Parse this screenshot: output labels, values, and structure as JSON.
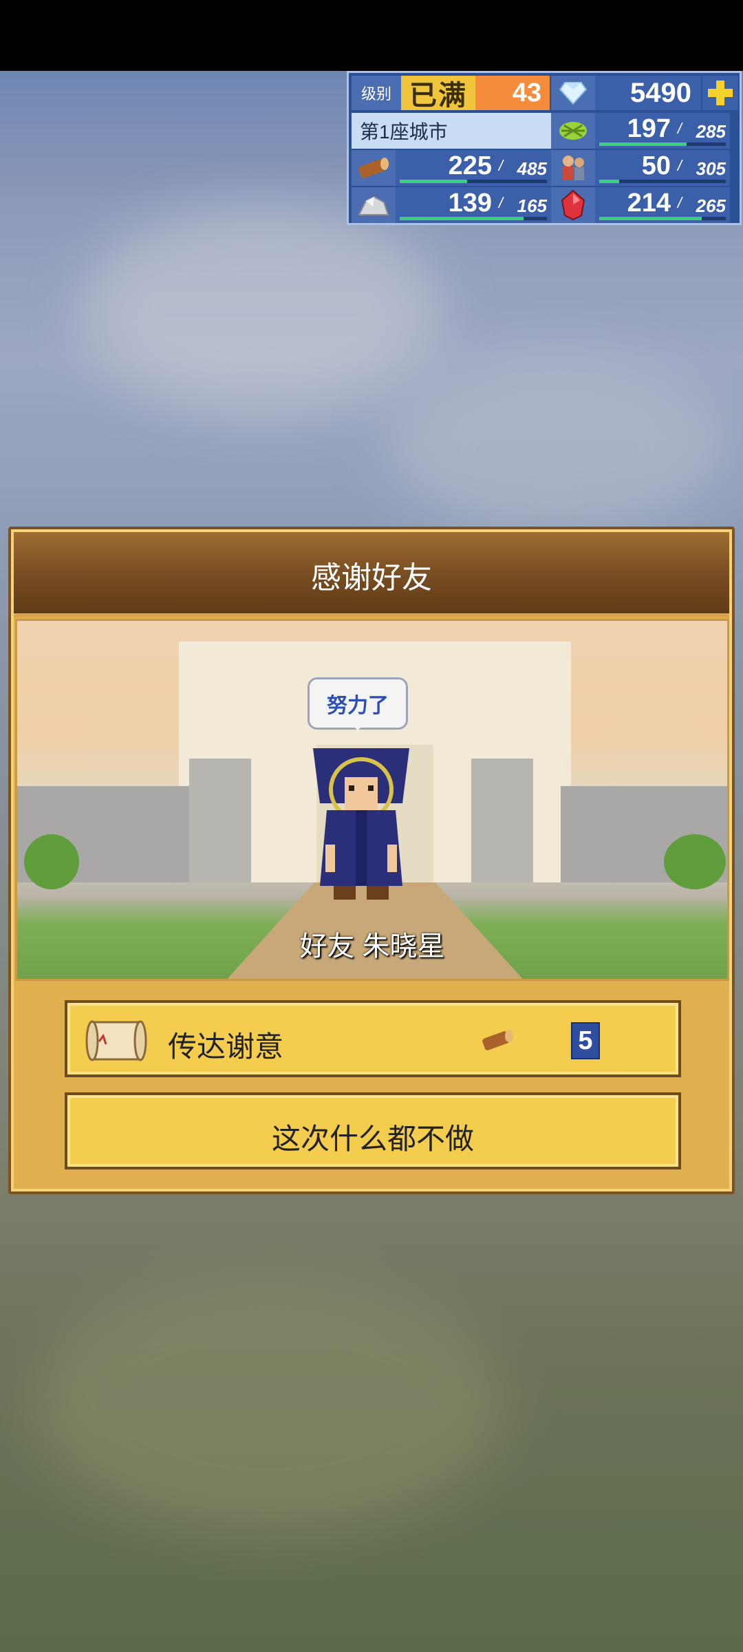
{
  "hud": {
    "level_label": "级别",
    "level_status": "已满",
    "level_value": "43",
    "gems": "5490",
    "city_name": "第1座城市",
    "resources": [
      {
        "icon": "grain-icon",
        "current": "197",
        "max": "285",
        "fill": 0.69
      },
      {
        "icon": "wood-log-icon",
        "current": "225",
        "max": "485",
        "fill": 0.46
      },
      {
        "icon": "workers-icon",
        "current": "50",
        "max": "305",
        "fill": 0.16
      },
      {
        "icon": "ore-icon",
        "current": "139",
        "max": "165",
        "fill": 0.84
      },
      {
        "icon": "red-gem-icon",
        "current": "214",
        "max": "265",
        "fill": 0.81
      }
    ]
  },
  "dialog": {
    "title": "感谢好友",
    "speech": "努力了",
    "friend_name": "好友 朱晓星",
    "thank_label": "传达谢意",
    "thank_cost": "5",
    "skip_label": "这次什么都不做"
  },
  "colors": {
    "hud_bg": "#2d4f94",
    "button_bg": "#f4cd4f",
    "header_bg": "#7a4e22",
    "level_orange": "#f48c3c"
  }
}
